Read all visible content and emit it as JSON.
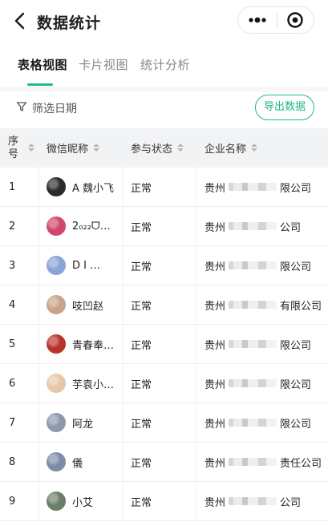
{
  "header": {
    "title": "数据统计",
    "icons": [
      "back-arrow-icon",
      "more-dots-icon",
      "target-icon"
    ]
  },
  "tabs": [
    {
      "label": "表格视图",
      "active": true
    },
    {
      "label": "卡片视图",
      "active": false
    },
    {
      "label": "统计分析",
      "active": false
    }
  ],
  "filter": {
    "label": "筛选日期",
    "export_label": "导出数据"
  },
  "table": {
    "columns": [
      "序号",
      "微信昵称",
      "参与状态",
      "企业名称"
    ],
    "seq_header_chars": [
      "序",
      "号"
    ],
    "rows": [
      {
        "idx": "1",
        "nickname": "A 魏小飞",
        "status": "正常",
        "company_left": "贵州",
        "company_right": "限公司",
        "avatar_color": "#2b2b2b"
      },
      {
        "idx": "2",
        "nickname": "2₀₂₂ᗜ…",
        "status": "正常",
        "company_left": "贵州",
        "company_right": "公司",
        "avatar_color": "#d0466d"
      },
      {
        "idx": "3",
        "nickname": "D I …",
        "status": "正常",
        "company_left": "贵州",
        "company_right": "限公司",
        "avatar_color": "#8aa4d8"
      },
      {
        "idx": "4",
        "nickname": "吱凹赵",
        "status": "正常",
        "company_left": "贵州",
        "company_right": "有限公司",
        "avatar_color": "#c9a489"
      },
      {
        "idx": "5",
        "nickname": "青春奉…",
        "status": "正常",
        "company_left": "贵州",
        "company_right": "限公司",
        "avatar_color": "#b8332d"
      },
      {
        "idx": "6",
        "nickname": "芋袁小…",
        "status": "正常",
        "company_left": "贵州",
        "company_right": "限公司",
        "avatar_color": "#e8c6a8"
      },
      {
        "idx": "7",
        "nickname": "阿龙",
        "status": "正常",
        "company_left": "贵州",
        "company_right": "限公司",
        "avatar_color": "#8c98ad"
      },
      {
        "idx": "8",
        "nickname": "儀",
        "status": "正常",
        "company_left": "贵州",
        "company_right": "责任公司",
        "avatar_color": "#7d8ca8"
      },
      {
        "idx": "9",
        "nickname": "小艾",
        "status": "正常",
        "company_left": "贵州",
        "company_right": "公司",
        "avatar_color": "#6a7e6a"
      }
    ]
  },
  "colors": {
    "accent": "#20b98a",
    "header_bg": "#f2f3f5",
    "text": "#1f1f1f",
    "muted": "#888888"
  }
}
